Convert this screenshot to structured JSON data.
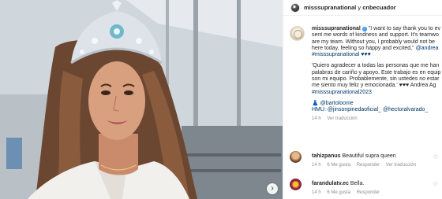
{
  "header": {
    "user1": "misssupranational",
    "join": "y",
    "user2": "cnbecuador"
  },
  "post": {
    "username": "misssupranational",
    "lines": [
      "\"I want to say thank you to ev",
      "sent me words of kindness and support. It's teamwo",
      "are my team. Without you, I probably would not be",
      "here today, feeling so happy and excited,\"",
      "#misssupranational ♥♥♥",
      "",
      "'Quiero agradecer a todas las personas que me han",
      "palabras de cariño y apoyo. Este trabajo es en equip",
      "son mi equipo. Probablemente, sin ustedes no estar",
      "me siento muy feliz y emocionada.' ♥♥♥ Andrea Ag",
      "#misssupranational2023",
      "",
      "👗 @bartoloome",
      "HMU: @jinsonpinedaoficial_ @hectoralvarado_"
    ],
    "mention_andrea": "@andrea",
    "time": "14 h",
    "translate": "Ver traducción"
  },
  "comments": [
    {
      "username": "tahizpanus",
      "text": "Beautiful supra queen",
      "time": "14 h",
      "likes": "6 Me gusta",
      "reply": "Responder",
      "translate": "Ver traducción"
    },
    {
      "username": "farandulatv.ec",
      "text": "Bella.",
      "time": "14 h",
      "likes": "6 Me gusta",
      "reply": "Responder"
    }
  ],
  "icons": {
    "next": "chevron-right-icon",
    "verified": "verified-badge-icon",
    "heart": "heart-icon"
  }
}
